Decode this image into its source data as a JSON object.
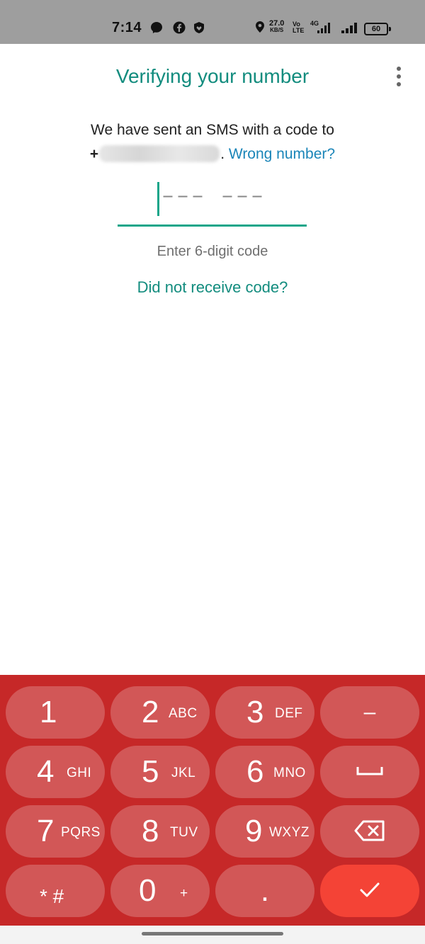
{
  "status_bar": {
    "time": "7:14",
    "net_speed_value": "27.0",
    "net_speed_unit": "KB/S",
    "volte_top": "Vo",
    "volte_bottom": "LTE",
    "network_type": "4G",
    "battery": "60",
    "icons": [
      "messenger-icon",
      "facebook-icon",
      "shield-heart-icon",
      "location-icon",
      "signal-icon",
      "signal-icon"
    ]
  },
  "header": {
    "title": "Verifying your number",
    "menu_icon": "more-vert-icon"
  },
  "message": {
    "line1": "We have sent an SMS with a code to",
    "plus": "+",
    "period": ".",
    "wrong_number_link": "Wrong number?"
  },
  "code_input": {
    "placeholder": "––– –––",
    "hint": "Enter 6-digit code"
  },
  "resend_link": "Did not receive code?",
  "keypad": {
    "keys": [
      {
        "num": "1",
        "letters": ""
      },
      {
        "num": "2",
        "letters": "ABC"
      },
      {
        "num": "3",
        "letters": "DEF"
      },
      {
        "num": "–",
        "letters": ""
      },
      {
        "num": "4",
        "letters": "GHI"
      },
      {
        "num": "5",
        "letters": "JKL"
      },
      {
        "num": "6",
        "letters": "MNO"
      },
      {
        "num": "␣",
        "letters": ""
      },
      {
        "num": "7",
        "letters": "PQRS"
      },
      {
        "num": "8",
        "letters": "TUV"
      },
      {
        "num": "9",
        "letters": "WXYZ"
      },
      {
        "num": "⌫",
        "letters": ""
      },
      {
        "num": "* #",
        "letters": ""
      },
      {
        "num": "0",
        "letters": "+"
      },
      {
        "num": ".",
        "letters": ""
      },
      {
        "num": "✓",
        "letters": ""
      }
    ]
  },
  "colors": {
    "accent": "#128c7e",
    "link": "#1a85b8",
    "keypad_bg": "#c62828",
    "confirm_key": "#f44336"
  }
}
